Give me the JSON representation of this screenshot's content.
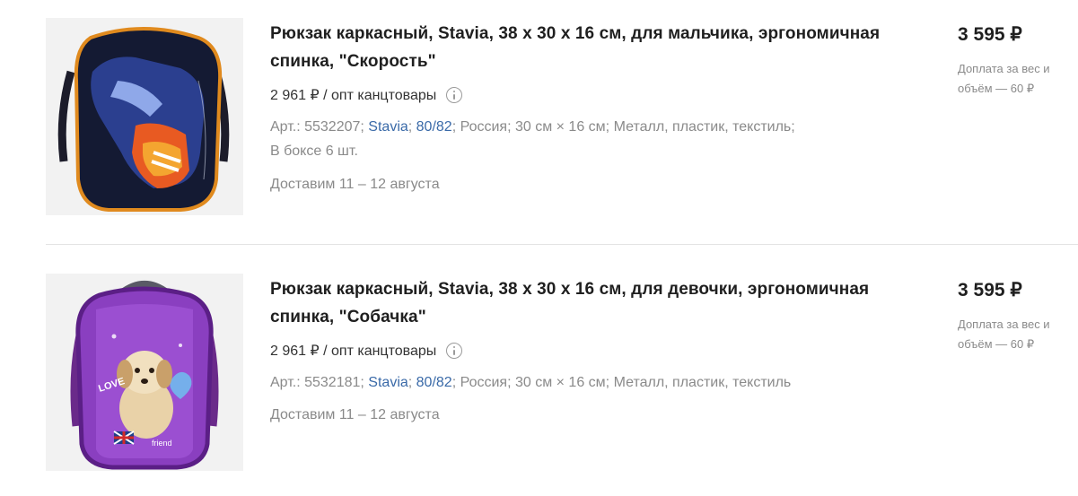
{
  "products": [
    {
      "title": "Рюкзак каркасный, Stavia, 38 х 30 х 16 см, для мальчика, эргономичная спинка, \"Скорость\"",
      "wholesale_price": "2 961 ₽ / опт канцтовары",
      "art": "Арт.: 5532207",
      "brand": "Stavia",
      "series": "80/82",
      "country": "Россия",
      "size": "30 см × 16 см",
      "material": "Металл, пластик, текстиль",
      "box": "В боксе 6 шт.",
      "delivery": "Доставим 11 – 12 августа",
      "price": "3 595 ₽",
      "surcharge": "Доплата за вес и объём — 60 ₽",
      "image_icon": "backpack-car-image"
    },
    {
      "title": "Рюкзак каркасный, Stavia, 38 х 30 х 16 см, для девочки, эргономичная спинка, \"Собачка\"",
      "wholesale_price": "2 961 ₽ / опт канцтовары",
      "art": "Арт.: 5532181",
      "brand": "Stavia",
      "series": "80/82",
      "country": "Россия",
      "size": "30 см × 16 см",
      "material": "Металл, пластик, текстиль",
      "delivery": "Доставим 11 – 12 августа",
      "price": "3 595 ₽",
      "surcharge": "Доплата за вес и объём — 60 ₽",
      "image_icon": "backpack-puppy-image",
      "image_text": [
        "LOVE",
        "friend"
      ]
    }
  ],
  "colors": {
    "link": "#3a6aa8",
    "muted": "#8a8a8a",
    "title": "#1f1f1f"
  }
}
